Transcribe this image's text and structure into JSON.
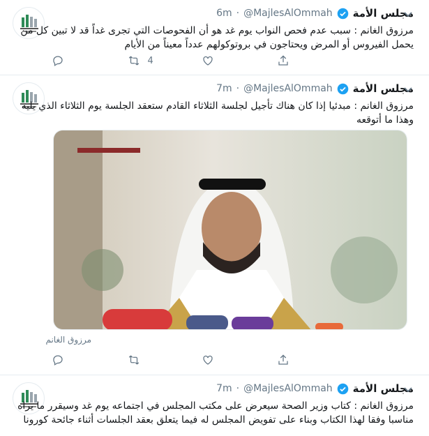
{
  "colors": {
    "verified": "#1da1f2",
    "text": "#14171a",
    "muted": "#657786",
    "divider": "#e6ecf0"
  },
  "tweets": [
    {
      "name": "مجلس الأمة",
      "handle": "@MajlesAlOmmah",
      "time": "6m",
      "text": "مرزوق الغانم : سبب عدم فحص النواب يوم غد هو أن الفحوصات التي تجرى غداً قد لا تبين كل من يحمل الفيروس أو المرض ويحتاجون في بروتوكولهم عدداً معيناً من الأيام",
      "retweets": "4",
      "replies": "",
      "likes": ""
    },
    {
      "name": "مجلس الأمة",
      "handle": "@MajlesAlOmmah",
      "time": "7m",
      "text": "مرزوق الغانم : مبدئيا إذا كان هناك تأجيل لجلسة الثلاثاء القادم ستعقد الجلسة يوم الثلاثاء الذي يليه وهذا ما أتوقعه",
      "media_caption": "مرزوق الغانم",
      "retweets": "",
      "replies": "",
      "likes": ""
    },
    {
      "name": "مجلس الأمة",
      "handle": "@MajlesAlOmmah",
      "time": "7m",
      "text": "مرزوق الغانم : كتاب وزير الصحة سيعرض على مكتب المجلس في اجتماعه يوم غد وسيقرر ما يراه مناسبا وفقا لهذا الكتاب وبناء على تفويض المجلس له فيما يتعلق بعقد الجلسات أثناء جائحة كورونا"
    }
  ],
  "icons": {
    "reply": "reply-icon",
    "retweet": "retweet-icon",
    "like": "heart-icon",
    "share": "share-icon",
    "verified": "verified-badge-icon",
    "caret": "chevron-down-icon"
  }
}
